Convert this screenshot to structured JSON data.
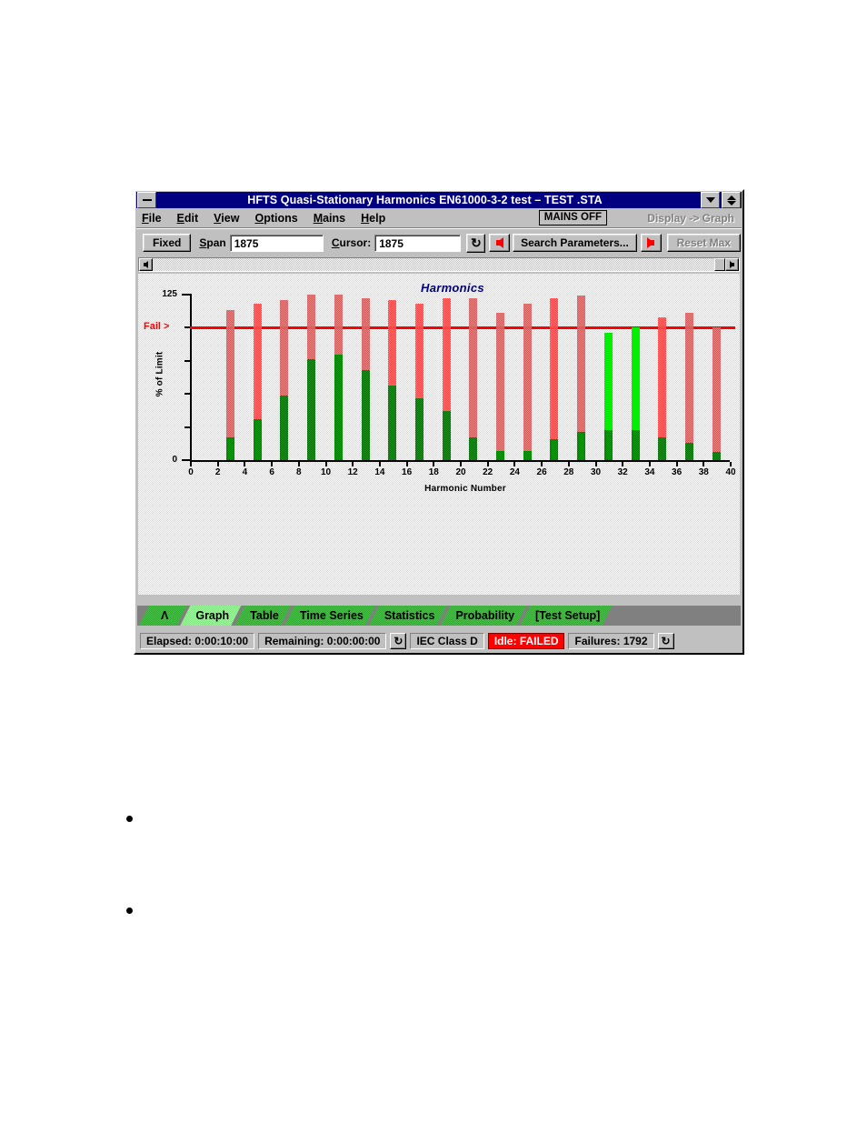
{
  "window": {
    "title": "HFTS Quasi-Stationary Harmonics EN61000-3-2 test – TEST .STA",
    "minimize_icon": "minimize-icon",
    "restore_icon": "restore-icon"
  },
  "menubar": {
    "items": [
      {
        "label": "File",
        "accel": "F"
      },
      {
        "label": "Edit",
        "accel": "E"
      },
      {
        "label": "View",
        "accel": "V"
      },
      {
        "label": "Options",
        "accel": "O"
      },
      {
        "label": "Mains",
        "accel": "M"
      },
      {
        "label": "Help",
        "accel": "H"
      }
    ],
    "mains_status": "MAINS OFF",
    "display_mode": "Display -> Graph"
  },
  "toolbar": {
    "fixed_label": "Fixed",
    "span_label": "Span",
    "span_value": "1875",
    "cursor_label": "Cursor:",
    "cursor_value": "1875",
    "refresh_icon": "refresh-icon",
    "prev_icon": "arrow-left-icon",
    "search_label": "Search Parameters...",
    "next_icon": "arrow-right-icon",
    "reset_max_label": "Reset Max"
  },
  "scrollbar": {
    "left_icon": "scroll-left-icon",
    "right_icon": "scroll-right-icon"
  },
  "chart_data": {
    "type": "bar",
    "title": "Harmonics",
    "xlabel": "Harmonic Number",
    "ylabel": "% of Limit",
    "xlim": [
      0,
      40
    ],
    "ylim": [
      0,
      125
    ],
    "ytick_labels": [
      "0",
      "125"
    ],
    "ytick_values": [
      0,
      125
    ],
    "yminor_ticks": [
      25,
      50,
      75,
      100
    ],
    "xtick_values": [
      0,
      2,
      4,
      6,
      8,
      10,
      12,
      14,
      16,
      18,
      20,
      22,
      24,
      26,
      28,
      30,
      32,
      34,
      36,
      38,
      40
    ],
    "xtick_labels": [
      "0",
      "2",
      "4",
      "6",
      "8",
      "10",
      "12",
      "14",
      "16",
      "18",
      "20",
      "22",
      "24",
      "26",
      "28",
      "30",
      "32",
      "34",
      "36",
      "38",
      "40"
    ],
    "grid": false,
    "legend": "none",
    "annotations": [
      {
        "text": "Fail >",
        "type": "threshold-label",
        "y": 100,
        "color": "#ff0000"
      }
    ],
    "threshold": {
      "label": "Fail >",
      "value": 100,
      "color": "#ff0000"
    },
    "series": [
      {
        "name": "Measured (dark green dithered)",
        "color": "#008000",
        "key": "measured"
      },
      {
        "name": "Maximum over pass (bright green)",
        "color": "#00ff00",
        "key": "max_pass"
      },
      {
        "name": "Maximum over fail (pink)",
        "color": "#fa8080",
        "key": "max_fail"
      }
    ],
    "categories": [
      3,
      5,
      7,
      9,
      11,
      13,
      15,
      17,
      19,
      21,
      23,
      25,
      27,
      29,
      31,
      33,
      35,
      37,
      39
    ],
    "bars": [
      {
        "harmonic": 3,
        "measured": 17,
        "max": 113,
        "max_state": "fail"
      },
      {
        "harmonic": 5,
        "measured": 31,
        "max": 118,
        "max_state": "fail"
      },
      {
        "harmonic": 7,
        "measured": 49,
        "max": 121,
        "max_state": "fail"
      },
      {
        "harmonic": 9,
        "measured": 76,
        "max": 125,
        "max_state": "fail"
      },
      {
        "harmonic": 11,
        "measured": 80,
        "max": 125,
        "max_state": "fail"
      },
      {
        "harmonic": 13,
        "measured": 68,
        "max": 122,
        "max_state": "fail"
      },
      {
        "harmonic": 15,
        "measured": 56,
        "max": 121,
        "max_state": "fail"
      },
      {
        "harmonic": 17,
        "measured": 47,
        "max": 118,
        "max_state": "fail"
      },
      {
        "harmonic": 19,
        "measured": 37,
        "max": 122,
        "max_state": "fail"
      },
      {
        "harmonic": 21,
        "measured": 17,
        "max": 122,
        "max_state": "fail"
      },
      {
        "harmonic": 23,
        "measured": 7,
        "max": 111,
        "max_state": "fail"
      },
      {
        "harmonic": 25,
        "measured": 7,
        "max": 118,
        "max_state": "fail"
      },
      {
        "harmonic": 27,
        "measured": 16,
        "max": 122,
        "max_state": "fail"
      },
      {
        "harmonic": 29,
        "measured": 21,
        "max": 124,
        "max_state": "fail"
      },
      {
        "harmonic": 31,
        "measured": 23,
        "max": 96,
        "max_state": "pass"
      },
      {
        "harmonic": 33,
        "measured": 23,
        "max": 100,
        "max_state": "pass"
      },
      {
        "harmonic": 35,
        "measured": 17,
        "max": 108,
        "max_state": "fail"
      },
      {
        "harmonic": 37,
        "measured": 13,
        "max": 111,
        "max_state": "fail"
      },
      {
        "harmonic": 39,
        "measured": 6,
        "max": 100,
        "max_state": "fail"
      }
    ]
  },
  "tabs": [
    {
      "label": "Λ",
      "name": "tab-scroll-prev",
      "active": false
    },
    {
      "label": "Graph",
      "name": "tab-graph",
      "active": true
    },
    {
      "label": "Table",
      "name": "tab-table",
      "active": false
    },
    {
      "label": "Time Series",
      "name": "tab-time-series",
      "active": false
    },
    {
      "label": "Statistics",
      "name": "tab-statistics",
      "active": false
    },
    {
      "label": "Probability",
      "name": "tab-probability",
      "active": false
    },
    {
      "label": "[Test Setup]",
      "name": "tab-test-setup",
      "active": false
    }
  ],
  "statusbar": {
    "elapsed": "Elapsed: 0:00:10:00",
    "remaining": "Remaining: 0:00:00:00",
    "refresh_icon_1": "refresh-icon",
    "iec_class": "IEC Class D",
    "state": "Idle: FAILED",
    "failures": "Failures: 1792",
    "refresh_icon_2": "refresh-icon"
  }
}
